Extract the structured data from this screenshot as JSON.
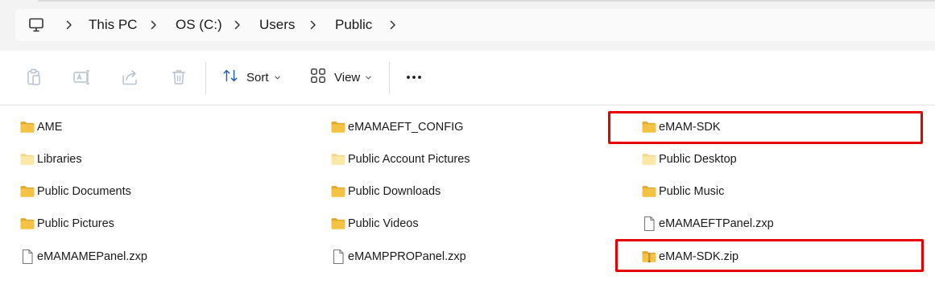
{
  "breadcrumb": {
    "items": [
      {
        "label": "This PC"
      },
      {
        "label": "OS (C:)"
      },
      {
        "label": "Users"
      },
      {
        "label": "Public"
      }
    ]
  },
  "toolbar": {
    "sort_label": "Sort",
    "view_label": "View",
    "icons": [
      "paste-icon",
      "rename-icon",
      "share-icon",
      "delete-icon",
      "more-icon"
    ]
  },
  "files": [
    {
      "name": "AME",
      "type": "folder"
    },
    {
      "name": "eMAMAEFT_CONFIG",
      "type": "folder"
    },
    {
      "name": "eMAM-SDK",
      "type": "folder",
      "highlighted": true
    },
    {
      "name": "Libraries",
      "type": "folder-light"
    },
    {
      "name": "Public Account Pictures",
      "type": "folder-light"
    },
    {
      "name": "Public Desktop",
      "type": "folder-light"
    },
    {
      "name": "Public Documents",
      "type": "folder"
    },
    {
      "name": "Public Downloads",
      "type": "folder"
    },
    {
      "name": "Public Music",
      "type": "folder"
    },
    {
      "name": "Public Pictures",
      "type": "folder"
    },
    {
      "name": "Public Videos",
      "type": "folder"
    },
    {
      "name": "eMAMAEFTPanel.zxp",
      "type": "file"
    },
    {
      "name": "eMAMAMEPanel.zxp",
      "type": "file"
    },
    {
      "name": "eMAMPPROPanel.zxp",
      "type": "file"
    },
    {
      "name": "eMAM-SDK.zip",
      "type": "zip",
      "highlighted": true
    }
  ],
  "colors": {
    "folder": "#f4c344",
    "folder_light": "#fbe7a6",
    "highlight": "#e60000"
  }
}
